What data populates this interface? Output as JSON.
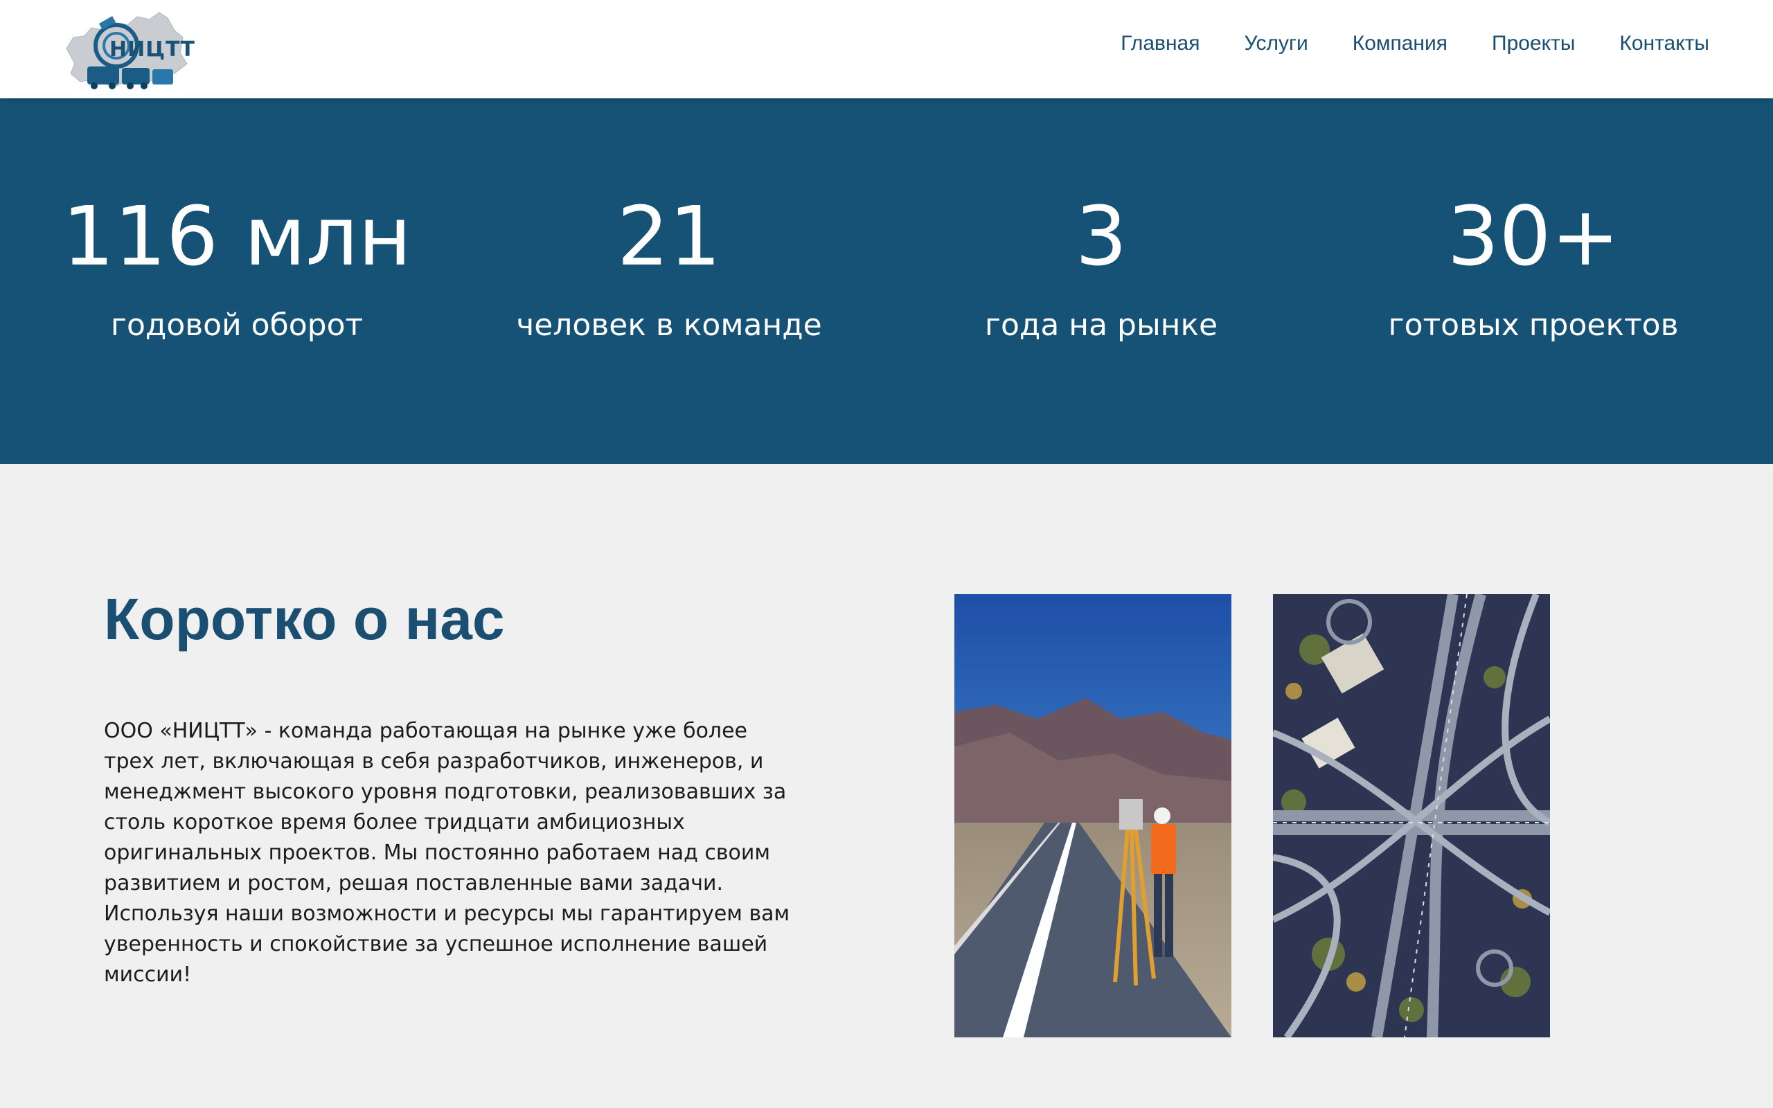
{
  "header": {
    "logo_alt": "logo-emblem",
    "logo_text": "НИЦТТ",
    "nav": [
      {
        "label": "Главная"
      },
      {
        "label": "Услуги"
      },
      {
        "label": "Компания"
      },
      {
        "label": "Проекты"
      },
      {
        "label": "Контакты"
      }
    ]
  },
  "stats": [
    {
      "value": "116 млн",
      "label": "годовой оборот"
    },
    {
      "value": "21",
      "label": "человек в команде"
    },
    {
      "value": "3",
      "label": "года на рынке"
    },
    {
      "value": "30+",
      "label": "готовых проектов"
    }
  ],
  "about": {
    "title": "Коротко о нас",
    "text": "ООО «НИЦТТ» - команда работающая на рынке уже более трех лет, включающая в себя разработчиков, инженеров, и менеджмент высокого уровня подготовки, реализовавших за столь короткое время более тридцати амбициозных оригинальных проектов. Мы постоянно работаем над своим развитием и ростом, решая поставленные вами задачи. Используя наши возможности и ресурсы мы гарантируем вам уверенность и спокойствие за успешное исполнение вашей миссии!",
    "photos": [
      {
        "subject": "surveyor-on-mountain-road"
      },
      {
        "subject": "aerial-highway-interchange"
      }
    ]
  },
  "colors": {
    "brand": "#165275",
    "heading": "#1b4f72",
    "background": "#f0f0f1"
  }
}
